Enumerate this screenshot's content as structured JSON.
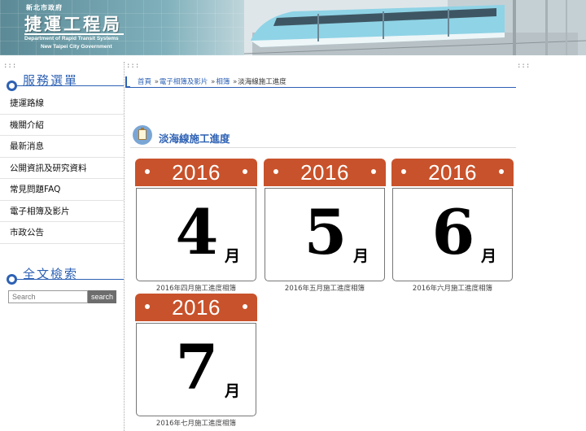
{
  "header": {
    "gov_name": "新北市政府",
    "bureau_name": "捷運工程局",
    "english_line1": "Department of Rapid Transit Systems",
    "english_line2": "New Taipei City Government"
  },
  "separators": {
    "dots": ":::"
  },
  "sidebar": {
    "menu_title": "服務選單",
    "items": [
      {
        "label": "捷運路線"
      },
      {
        "label": "機關介紹"
      },
      {
        "label": "最新消息"
      },
      {
        "label": "公開資訊及研究資料"
      },
      {
        "label": "常見問題FAQ"
      },
      {
        "label": "電子相簿及影片"
      },
      {
        "label": "市政公告"
      }
    ],
    "search_title": "全文檢索",
    "search_placeholder": "Search",
    "search_button": "search"
  },
  "breadcrumb": {
    "items": [
      "首頁",
      "電子相簿及影片",
      "相簿",
      "淡海線施工進度"
    ],
    "separator": "»"
  },
  "section": {
    "title": "淡海線施工進度"
  },
  "albums": [
    {
      "year": "2016",
      "month": "4",
      "month_suffix": "月",
      "caption": "2016年四月施工進度相簿"
    },
    {
      "year": "2016",
      "month": "5",
      "month_suffix": "月",
      "caption": "2016年五月施工進度相簿"
    },
    {
      "year": "2016",
      "month": "6",
      "month_suffix": "月",
      "caption": "2016年六月施工進度相簿"
    },
    {
      "year": "2016",
      "month": "7",
      "month_suffix": "月",
      "caption": "2016年七月施工進度相簿"
    }
  ],
  "colors": {
    "accent": "#2d61b4",
    "calendar_cap": "#c8522b"
  }
}
